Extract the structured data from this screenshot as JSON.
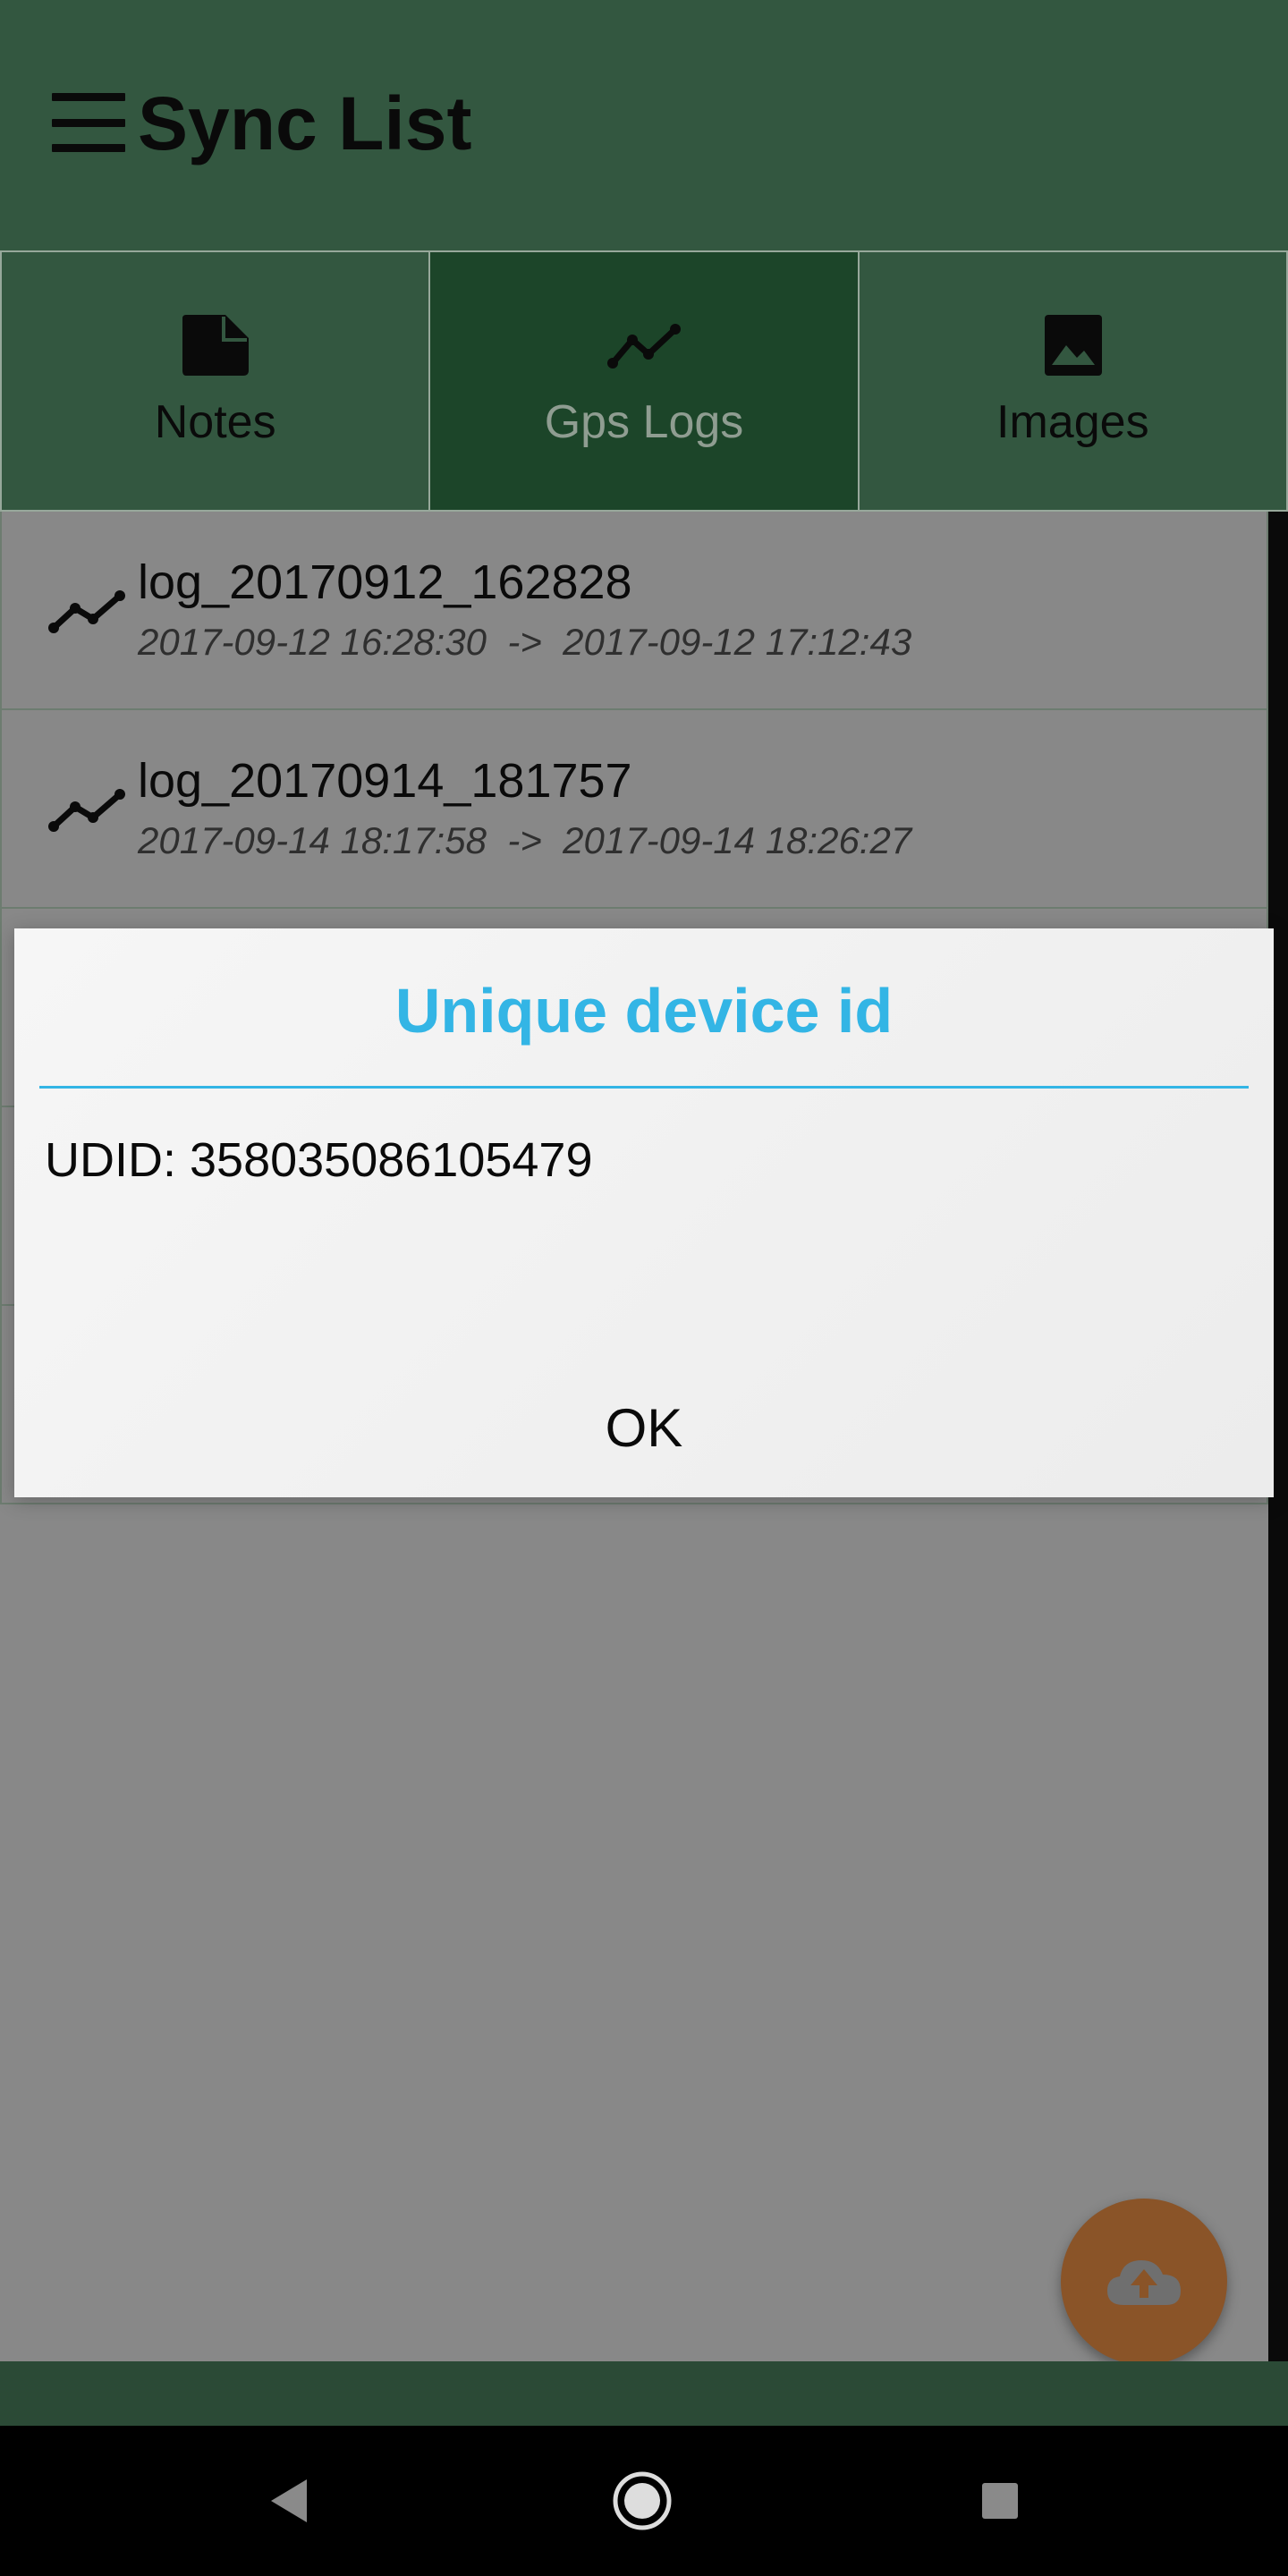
{
  "app_bar": {
    "title": "Sync List",
    "menu_icon": "hamburger-menu-icon"
  },
  "tabs": [
    {
      "label": "Notes",
      "icon": "note-icon",
      "active": false
    },
    {
      "label": "Gps Logs",
      "icon": "gps-track-icon",
      "active": true
    },
    {
      "label": "Images",
      "icon": "image-icon",
      "active": false
    }
  ],
  "logs": [
    {
      "name": "log_20170912_162828",
      "start": "2017-09-12 16:28:30",
      "end": "2017-09-12 17:12:43",
      "range": "2017-09-12 16:28:30  ->  2017-09-12 17:12:43"
    },
    {
      "name": "log_20170914_181757",
      "start": "2017-09-14 18:17:58",
      "end": "2017-09-14 18:26:27",
      "range": "2017-09-14 18:17:58  ->  2017-09-14 18:26:27"
    }
  ],
  "dialog": {
    "title": "Unique device id",
    "body": "UDID: 358035086105479",
    "ok_label": "OK",
    "accent": "#33b5e5"
  },
  "fab": {
    "icon": "cloud-upload-icon"
  },
  "colors": {
    "primary": "#335740",
    "tab_active": "#1c4529",
    "fab": "#8a5428"
  },
  "nav": {
    "back_icon": "back-icon",
    "home_icon": "home-icon",
    "recents_icon": "recents-icon"
  }
}
